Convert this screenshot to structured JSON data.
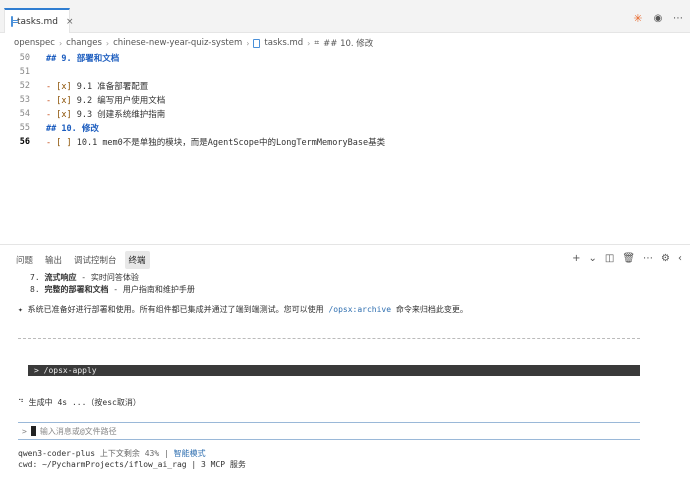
{
  "tab": {
    "filename": "tasks.md",
    "close": "×"
  },
  "tab_actions": {
    "ai_icon": "✳",
    "preview_icon": "◉",
    "more_icon": "⋯"
  },
  "breadcrumb": [
    "openspec",
    "changes",
    "chinese-new-year-quiz-system",
    "tasks.md",
    "## 10. 修改"
  ],
  "breadcrumb_sep": "›",
  "breadcrumb_hash_icon": "⌗",
  "editor": {
    "lines": [
      {
        "num": "50",
        "text": "## 9. 部署和文档"
      },
      {
        "num": "51",
        "text": ""
      },
      {
        "num": "52",
        "text": "- [x] 9.1 准备部署配置"
      },
      {
        "num": "53",
        "text": "- [x] 9.2 编写用户使用文档"
      },
      {
        "num": "54",
        "text": "- [x] 9.3 创建系统维护指南"
      },
      {
        "num": "55",
        "text": "## 10. 修改"
      },
      {
        "num": "56",
        "text": "- [ ] 10.1 mem0不是单独的模块，而是AgentScope中的LongTermMemoryBase基类"
      }
    ]
  },
  "panel": {
    "tabs": [
      "问题",
      "输出",
      "调试控制台",
      "终端"
    ],
    "actions": {
      "add": "+",
      "dropdown": "⌄",
      "split": "◫",
      "trash": "🗑",
      "more": "⋯",
      "settings": "⚙",
      "chevron": "‹"
    }
  },
  "terminal": {
    "line1_num": "7. ",
    "line1_bold": "流式响应",
    "line1_rest": " - 实时问答体验",
    "line2_num": "8. ",
    "line2_bold": "完整的部署和文档",
    "line2_rest": " - 用户指南和维护手册",
    "status_prefix": "✦ 系统已准备好进行部署和使用。所有组件都已集成并通过了端到端测试。您可以使用 ",
    "status_cmd": "/opsx:archive",
    "status_suffix": " 命令来归档此变更。",
    "command": " > /opsx-apply",
    "generating": "⠙ 生成中 4s ...（按esc取消）",
    "input_prompt": ">",
    "input_placeholder": "输入消息或@文件路径",
    "model": "qwen3-coder-plus",
    "context": " 上下文剩余 43% | ",
    "mode": "智能模式",
    "cwd": "cwd: ~/PycharmProjects/iflow_ai_rag | 3 MCP 服务"
  }
}
